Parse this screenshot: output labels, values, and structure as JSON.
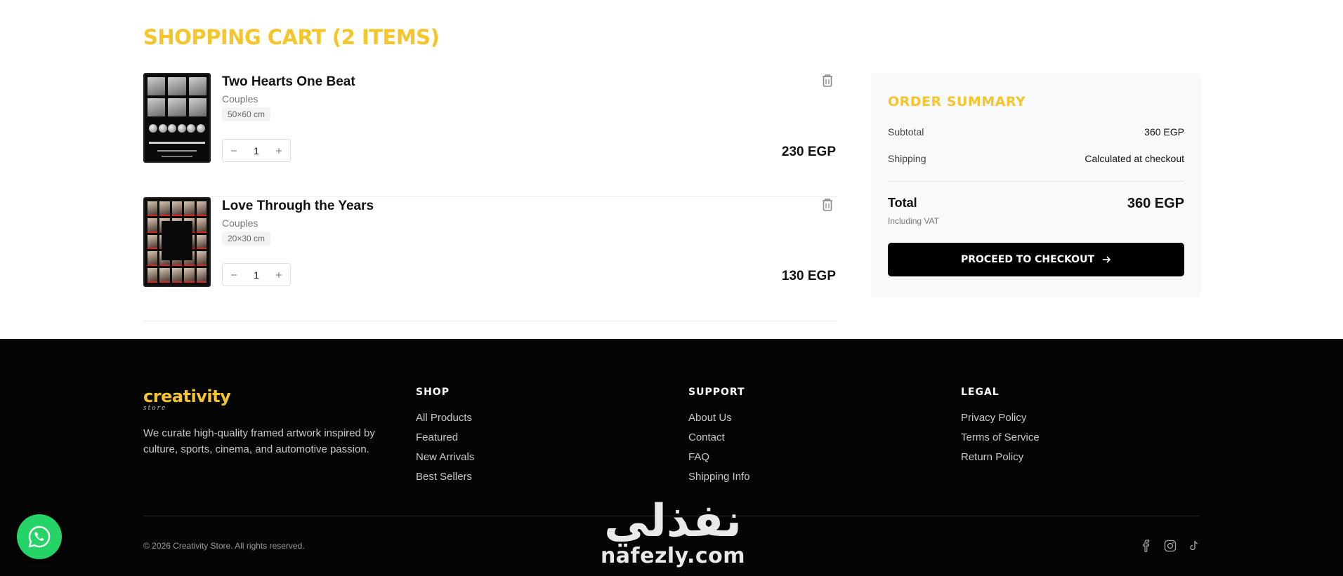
{
  "cart": {
    "title": "SHOPPING CART (2 ITEMS)",
    "items": [
      {
        "name": "Two Hearts One Beat",
        "category": "Couples",
        "size": "50×60 cm",
        "quantity": "1",
        "price": "230 EGP",
        "decrease_icon": "minus-icon",
        "increase_icon": "plus-icon",
        "remove_icon": "trash-icon"
      },
      {
        "name": "Love Through the Years",
        "category": "Couples",
        "size": "20×30 cm",
        "quantity": "1",
        "price": "130 EGP",
        "decrease_icon": "minus-icon",
        "increase_icon": "plus-icon",
        "remove_icon": "trash-icon"
      }
    ]
  },
  "summary": {
    "title": "ORDER SUMMARY",
    "subtotal_label": "Subtotal",
    "subtotal_value": "360 EGP",
    "shipping_label": "Shipping",
    "shipping_value": "Calculated at checkout",
    "total_label": "Total",
    "total_value": "360 EGP",
    "vat_note": "Including VAT",
    "checkout_label": "PROCEED TO CHECKOUT",
    "checkout_icon": "arrow-right-icon"
  },
  "footer": {
    "logo_main": "creativity",
    "logo_sub": "store",
    "about": "We curate high-quality framed artwork inspired by culture, sports, cinema, and automotive passion.",
    "shop": {
      "heading": "SHOP",
      "links": [
        "All Products",
        "Featured",
        "New Arrivals",
        "Best Sellers"
      ]
    },
    "support": {
      "heading": "SUPPORT",
      "links": [
        "About Us",
        "Contact",
        "FAQ",
        "Shipping Info"
      ]
    },
    "legal": {
      "heading": "LEGAL",
      "links": [
        "Privacy Policy",
        "Terms of Service",
        "Return Policy"
      ]
    },
    "copyright": "© 2026 Creativity Store. All rights reserved.",
    "socials": [
      "facebook-icon",
      "instagram-icon",
      "tiktok-icon"
    ]
  },
  "watermark": {
    "arabic": "نفذلي",
    "latin": "nafezly.com"
  },
  "whatsapp_icon": "whatsapp-icon",
  "colors": {
    "accent": "#f5c52a",
    "footer_bg": "#050505",
    "checkout_bg": "#000000",
    "whatsapp": "#25d366"
  }
}
